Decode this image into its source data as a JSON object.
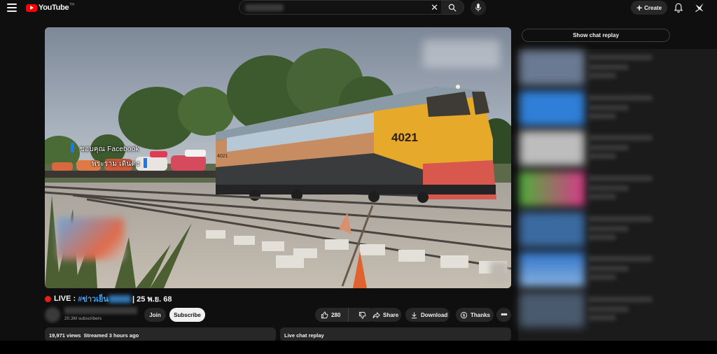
{
  "masthead": {
    "logo_text": "YouTube",
    "logo_superscript": "TH",
    "search_clear_glyph": "✕",
    "create_label": "Create",
    "icons": [
      "menu-icon",
      "search-icon",
      "mic-icon",
      "plus-icon",
      "bell-icon",
      "avatar"
    ]
  },
  "video": {
    "overlay_line1": "ขอบคุณ Facebook",
    "overlay_line2": "พระราม เดินดง",
    "locomotive_number": "4021",
    "locomotive_number_small": "4021"
  },
  "title": {
    "live_label": "LIVE :",
    "hashtag": "#ข่าวเย็น",
    "date_text": "| 25 พ.ย. 68"
  },
  "channel": {
    "subscribers": "20.3M subscribers",
    "join_label": "Join",
    "subscribe_label": "Subscribe"
  },
  "actions": {
    "like_count": "280",
    "share_label": "Share",
    "download_label": "Download",
    "thanks_label": "Thanks",
    "more_glyph": "•••"
  },
  "description": {
    "views": "19,971 views",
    "streamed": "Streamed 3 hours ago"
  },
  "live_chat": {
    "label": "Live chat replay",
    "show_replay_label": "Show chat replay"
  },
  "colors": {
    "background": "#0f0f0f",
    "brand_red": "#ff0000",
    "live_red": "#e62117",
    "link_blue": "#3ea6ff",
    "pill_bg": "#272727"
  }
}
